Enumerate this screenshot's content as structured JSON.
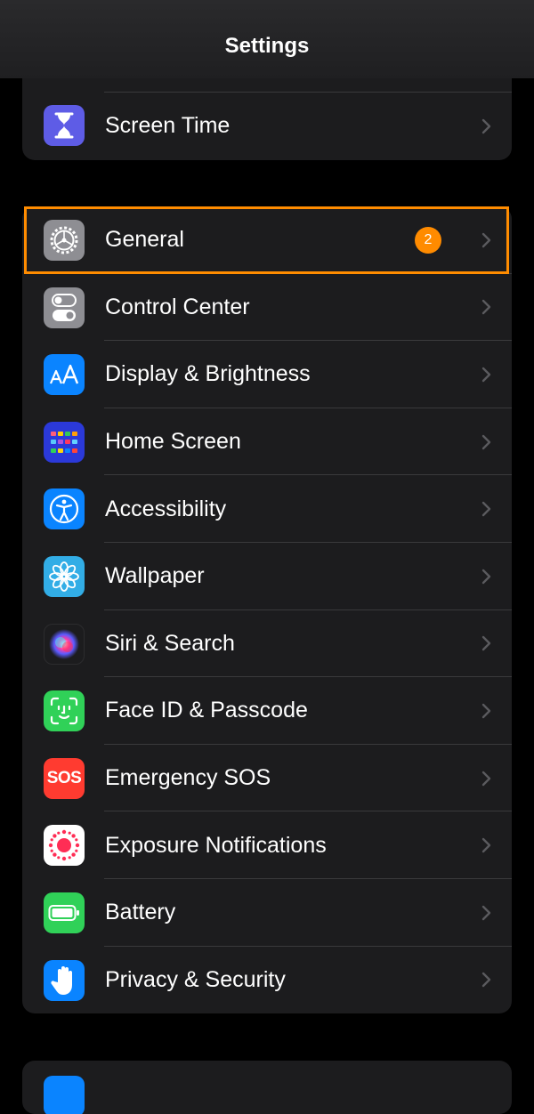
{
  "header": {
    "title": "Settings"
  },
  "group_top": {
    "items": [
      {
        "label": "Screen Time",
        "icon": "hourglass-icon",
        "color": "#5e5ce6"
      }
    ]
  },
  "group_main": {
    "items": [
      {
        "label": "General",
        "icon": "gear-icon",
        "color": "#8e8e93",
        "badge": "2"
      },
      {
        "label": "Control Center",
        "icon": "toggles-icon",
        "color": "#8e8e93"
      },
      {
        "label": "Display & Brightness",
        "icon": "text-size-icon",
        "color": "#0a84ff"
      },
      {
        "label": "Home Screen",
        "icon": "app-grid-icon",
        "color": "#2b39d9"
      },
      {
        "label": "Accessibility",
        "icon": "accessibility-icon",
        "color": "#0a84ff"
      },
      {
        "label": "Wallpaper",
        "icon": "flower-icon",
        "color": "#32ade6"
      },
      {
        "label": "Siri & Search",
        "icon": "siri-icon",
        "color": "#1c1c1e"
      },
      {
        "label": "Face ID & Passcode",
        "icon": "face-id-icon",
        "color": "#30d158"
      },
      {
        "label": "Emergency SOS",
        "icon": "sos-icon",
        "sos_text": "SOS",
        "color": "#ff3b30"
      },
      {
        "label": "Exposure Notifications",
        "icon": "exposure-icon",
        "color": "#ffffff"
      },
      {
        "label": "Battery",
        "icon": "battery-icon",
        "color": "#30d158"
      },
      {
        "label": "Privacy & Security",
        "icon": "hand-icon",
        "color": "#0a84ff"
      }
    ]
  },
  "colors": {
    "accent_highlight": "#ff8c00",
    "badge": "#ff8b00",
    "chevron": "#5a5a5e",
    "separator": "#3a3a3c"
  }
}
